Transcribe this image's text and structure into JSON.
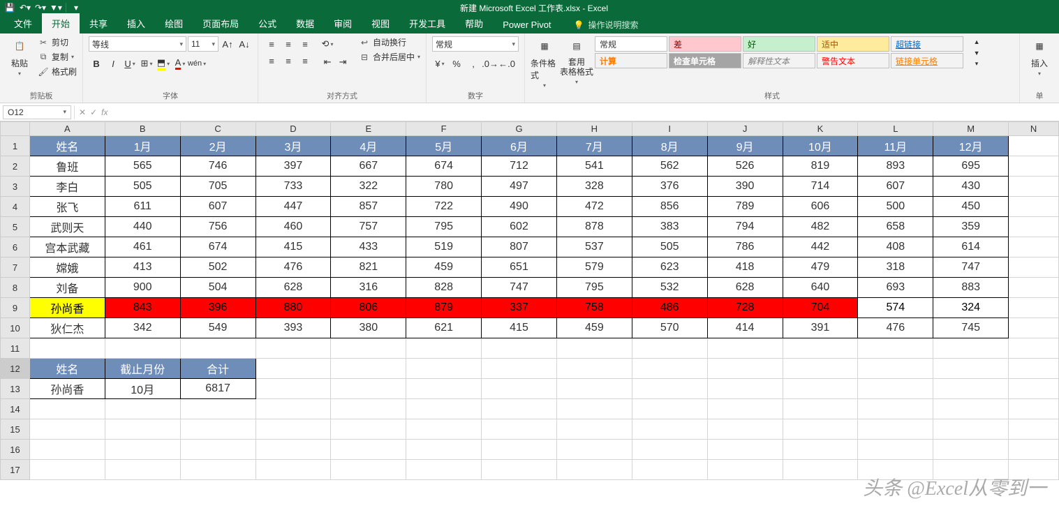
{
  "app": {
    "title": "新建 Microsoft Excel 工作表.xlsx  -  Excel"
  },
  "tabs": [
    "文件",
    "开始",
    "共享",
    "插入",
    "绘图",
    "页面布局",
    "公式",
    "数据",
    "审阅",
    "视图",
    "开发工具",
    "帮助",
    "Power Pivot"
  ],
  "tell_me": "操作说明搜索",
  "ribbon": {
    "clipboard": {
      "paste": "粘贴",
      "cut": "剪切",
      "copy": "复制",
      "painter": "格式刷",
      "label": "剪贴板"
    },
    "font": {
      "name": "等线",
      "size": "11",
      "label": "字体"
    },
    "align": {
      "wrap": "自动换行",
      "merge": "合并后居中",
      "label": "对齐方式"
    },
    "number": {
      "format": "常规",
      "label": "数字"
    },
    "styles": {
      "cond": "条件格式",
      "table": "套用\n表格格式",
      "row1": [
        "常规",
        "差",
        "好",
        "适中",
        "超链接"
      ],
      "row2": [
        "计算",
        "检查单元格",
        "解释性文本",
        "警告文本",
        "链接单元格"
      ],
      "label": "样式"
    },
    "cells": {
      "insert": "插入",
      "label": "单"
    }
  },
  "namebox": "O12",
  "columns": [
    "A",
    "B",
    "C",
    "D",
    "E",
    "F",
    "G",
    "H",
    "I",
    "J",
    "K",
    "L",
    "M",
    "N"
  ],
  "rows": [
    "1",
    "2",
    "3",
    "4",
    "5",
    "6",
    "7",
    "8",
    "9",
    "10",
    "11",
    "12",
    "13",
    "14",
    "15",
    "16",
    "17"
  ],
  "chart_data": {
    "type": "table",
    "headers": [
      "姓名",
      "1月",
      "2月",
      "3月",
      "4月",
      "5月",
      "6月",
      "7月",
      "8月",
      "9月",
      "10月",
      "11月",
      "12月"
    ],
    "rows": [
      [
        "鲁班",
        565,
        746,
        397,
        667,
        674,
        712,
        541,
        562,
        526,
        819,
        893,
        695
      ],
      [
        "李白",
        505,
        705,
        733,
        322,
        780,
        497,
        328,
        376,
        390,
        714,
        607,
        430
      ],
      [
        "张飞",
        611,
        607,
        447,
        857,
        722,
        490,
        472,
        856,
        789,
        606,
        500,
        450
      ],
      [
        "武则天",
        440,
        756,
        460,
        757,
        795,
        602,
        878,
        383,
        794,
        482,
        658,
        359
      ],
      [
        "宫本武藏",
        461,
        674,
        415,
        433,
        519,
        807,
        537,
        505,
        786,
        442,
        408,
        614
      ],
      [
        "嫦娥",
        413,
        502,
        476,
        821,
        459,
        651,
        579,
        623,
        418,
        479,
        318,
        747
      ],
      [
        "刘备",
        900,
        504,
        628,
        316,
        828,
        747,
        795,
        532,
        628,
        640,
        693,
        883
      ],
      [
        "孙尚香",
        843,
        396,
        880,
        806,
        879,
        337,
        758,
        486,
        728,
        704,
        574,
        324
      ],
      [
        "狄仁杰",
        342,
        549,
        393,
        380,
        621,
        415,
        459,
        570,
        414,
        391,
        476,
        745
      ]
    ],
    "summary": {
      "headers": [
        "姓名",
        "截止月份",
        "合计"
      ],
      "row": [
        "孙尚香",
        "10月",
        6817
      ]
    }
  },
  "watermark": "头条 @Excel从零到一"
}
